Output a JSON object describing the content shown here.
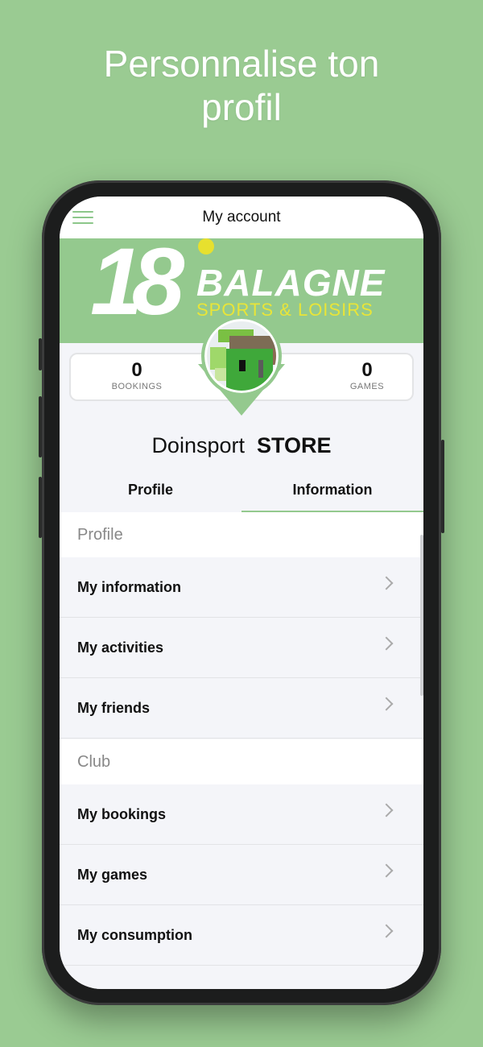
{
  "headline": {
    "line1": "Personnalise ton",
    "line2": "profil"
  },
  "topbar": {
    "title": "My account"
  },
  "banner": {
    "logo_number": "18",
    "logo_name": "BALAGNE",
    "logo_sub": "SPORTS & LOISIRS"
  },
  "stats": {
    "bookings": {
      "value": "0",
      "label": "BOOKINGS"
    },
    "games": {
      "value": "0",
      "label": "GAMES"
    }
  },
  "user": {
    "first": "Doinsport",
    "last": "STORE"
  },
  "tabs": [
    {
      "label": "Profile"
    },
    {
      "label": "Information"
    }
  ],
  "sections": {
    "profile": {
      "title": "Profile",
      "items": [
        "My information",
        "My activities",
        "My friends"
      ]
    },
    "club": {
      "title": "Club",
      "items": [
        "My bookings",
        "My games",
        "My consumption"
      ]
    }
  },
  "colors": {
    "background": "#9acb92",
    "accent": "#94c98e",
    "logo_yellow": "#e9e538"
  }
}
